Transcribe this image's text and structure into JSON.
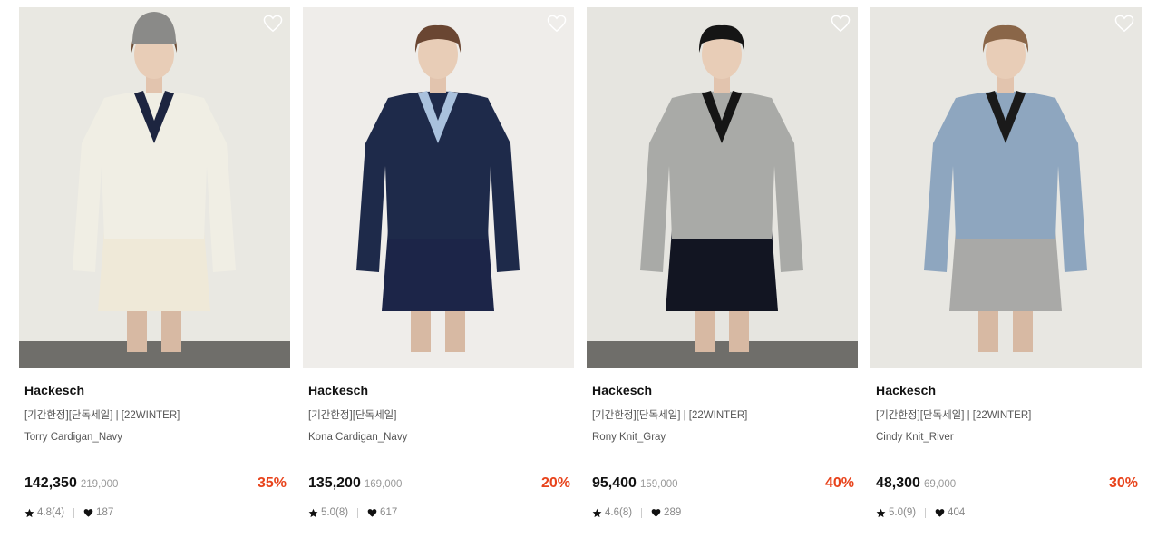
{
  "products": [
    {
      "brand": "Hackesch",
      "tags": "[기간한정][단독세일] | [22WINTER]",
      "name": "Torry Cardigan_Navy",
      "price": "142,350",
      "original_price": "219,000",
      "discount": "35%",
      "rating": "4.8(4)",
      "likes": "187",
      "figure": {
        "bg": "#e9e8e2",
        "top": "#f0eee4",
        "accent": "#1d2540",
        "bottom": "#efe9d8",
        "hair": "#6b4a33",
        "hat": "#8a8a88"
      }
    },
    {
      "brand": "Hackesch",
      "tags": "[기간한정][단독세일]",
      "name": "Kona Cardigan_Navy",
      "price": "135,200",
      "original_price": "169,000",
      "discount": "20%",
      "rating": "5.0(8)",
      "likes": "617",
      "figure": {
        "bg": "#efedea",
        "top": "#1e2a4a",
        "accent": "#a9c1dd",
        "bottom": "#1c2548",
        "hair": "#6a4632",
        "hat": ""
      }
    },
    {
      "brand": "Hackesch",
      "tags": "[기간한정][단독세일] | [22WINTER]",
      "name": "Rony Knit_Gray",
      "price": "95,400",
      "original_price": "159,000",
      "discount": "40%",
      "rating": "4.6(8)",
      "likes": "289",
      "figure": {
        "bg": "#e6e5e0",
        "top": "#a9aaa7",
        "accent": "#151515",
        "bottom": "#121522",
        "hair": "#151515",
        "hat": ""
      }
    },
    {
      "brand": "Hackesch",
      "tags": "[기간한정][단독세일] | [22WINTER]",
      "name": "Cindy Knit_River",
      "price": "48,300",
      "original_price": "69,000",
      "discount": "30%",
      "rating": "5.0(9)",
      "likes": "404",
      "figure": {
        "bg": "#e8e7e2",
        "top": "#8ea6bf",
        "accent": "#1a1a1a",
        "bottom": "#a9a9a7",
        "hair": "#8a6648",
        "hat": ""
      }
    }
  ],
  "colors": {
    "discount": "#e8431b",
    "text": "#111111",
    "muted": "#555555"
  },
  "icons": {
    "wishlist": "heart-outline-icon",
    "rating": "star-icon",
    "likes": "heart-filled-icon"
  }
}
